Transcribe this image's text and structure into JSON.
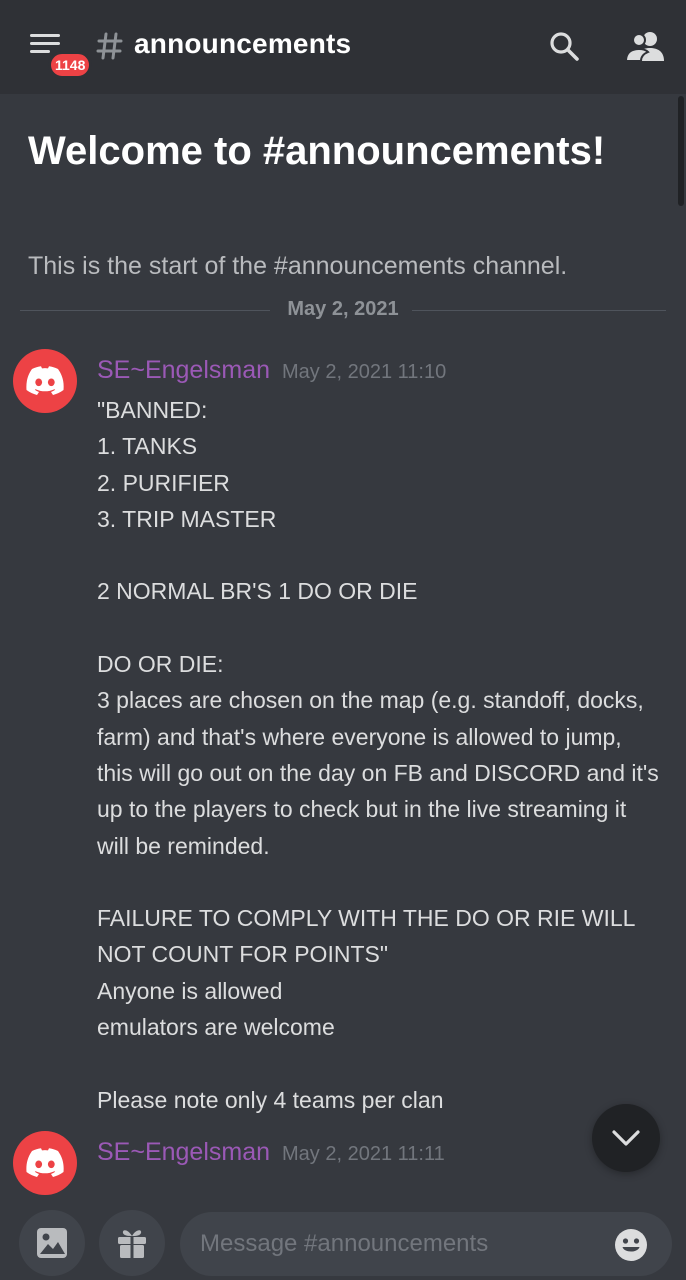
{
  "header": {
    "badge_count": "1148",
    "channel_name": "announcements"
  },
  "welcome": {
    "title": "Welcome to #announcements!",
    "subtitle": "This is the start of the #announcements channel.",
    "date_divider": "May 2, 2021"
  },
  "messages": [
    {
      "author": "SE~Engelsman",
      "timestamp": "May 2, 2021 11:10",
      "lines": [
        "\"BANNED:",
        "1. TANKS",
        "2. PURIFIER",
        "3. TRIP MASTER",
        "",
        "2 NORMAL BR'S 1 DO OR DIE",
        "",
        "DO OR DIE:",
        "3 places are chosen on the map (e.g. standoff, docks,",
        "farm) and that's where everyone is allowed to jump,",
        "this will go out on the day on FB and DISCORD and it's",
        "up to the players to check but in the live streaming it",
        "will be reminded.",
        "",
        "FAILURE TO COMPLY WITH THE DO OR RIE WILL",
        "NOT COUNT FOR POINTS\"",
        "Anyone is allowed",
        "emulators are welcome",
        "",
        "Please note only 4 teams per clan"
      ]
    },
    {
      "author": "SE~Engelsman",
      "timestamp": "May 2, 2021 11:11"
    }
  ],
  "composer": {
    "placeholder": "Message #announcements"
  },
  "colors": {
    "background": "#36393f",
    "header": "#2f3136",
    "author": "#9b59b6",
    "avatar": "#ed4245",
    "badge": "#ed4245"
  },
  "icons": [
    "menu-icon",
    "hash-icon",
    "search-icon",
    "members-icon",
    "discord-logo-icon",
    "chevron-down-icon",
    "image-icon",
    "gift-icon",
    "emoji-icon"
  ]
}
